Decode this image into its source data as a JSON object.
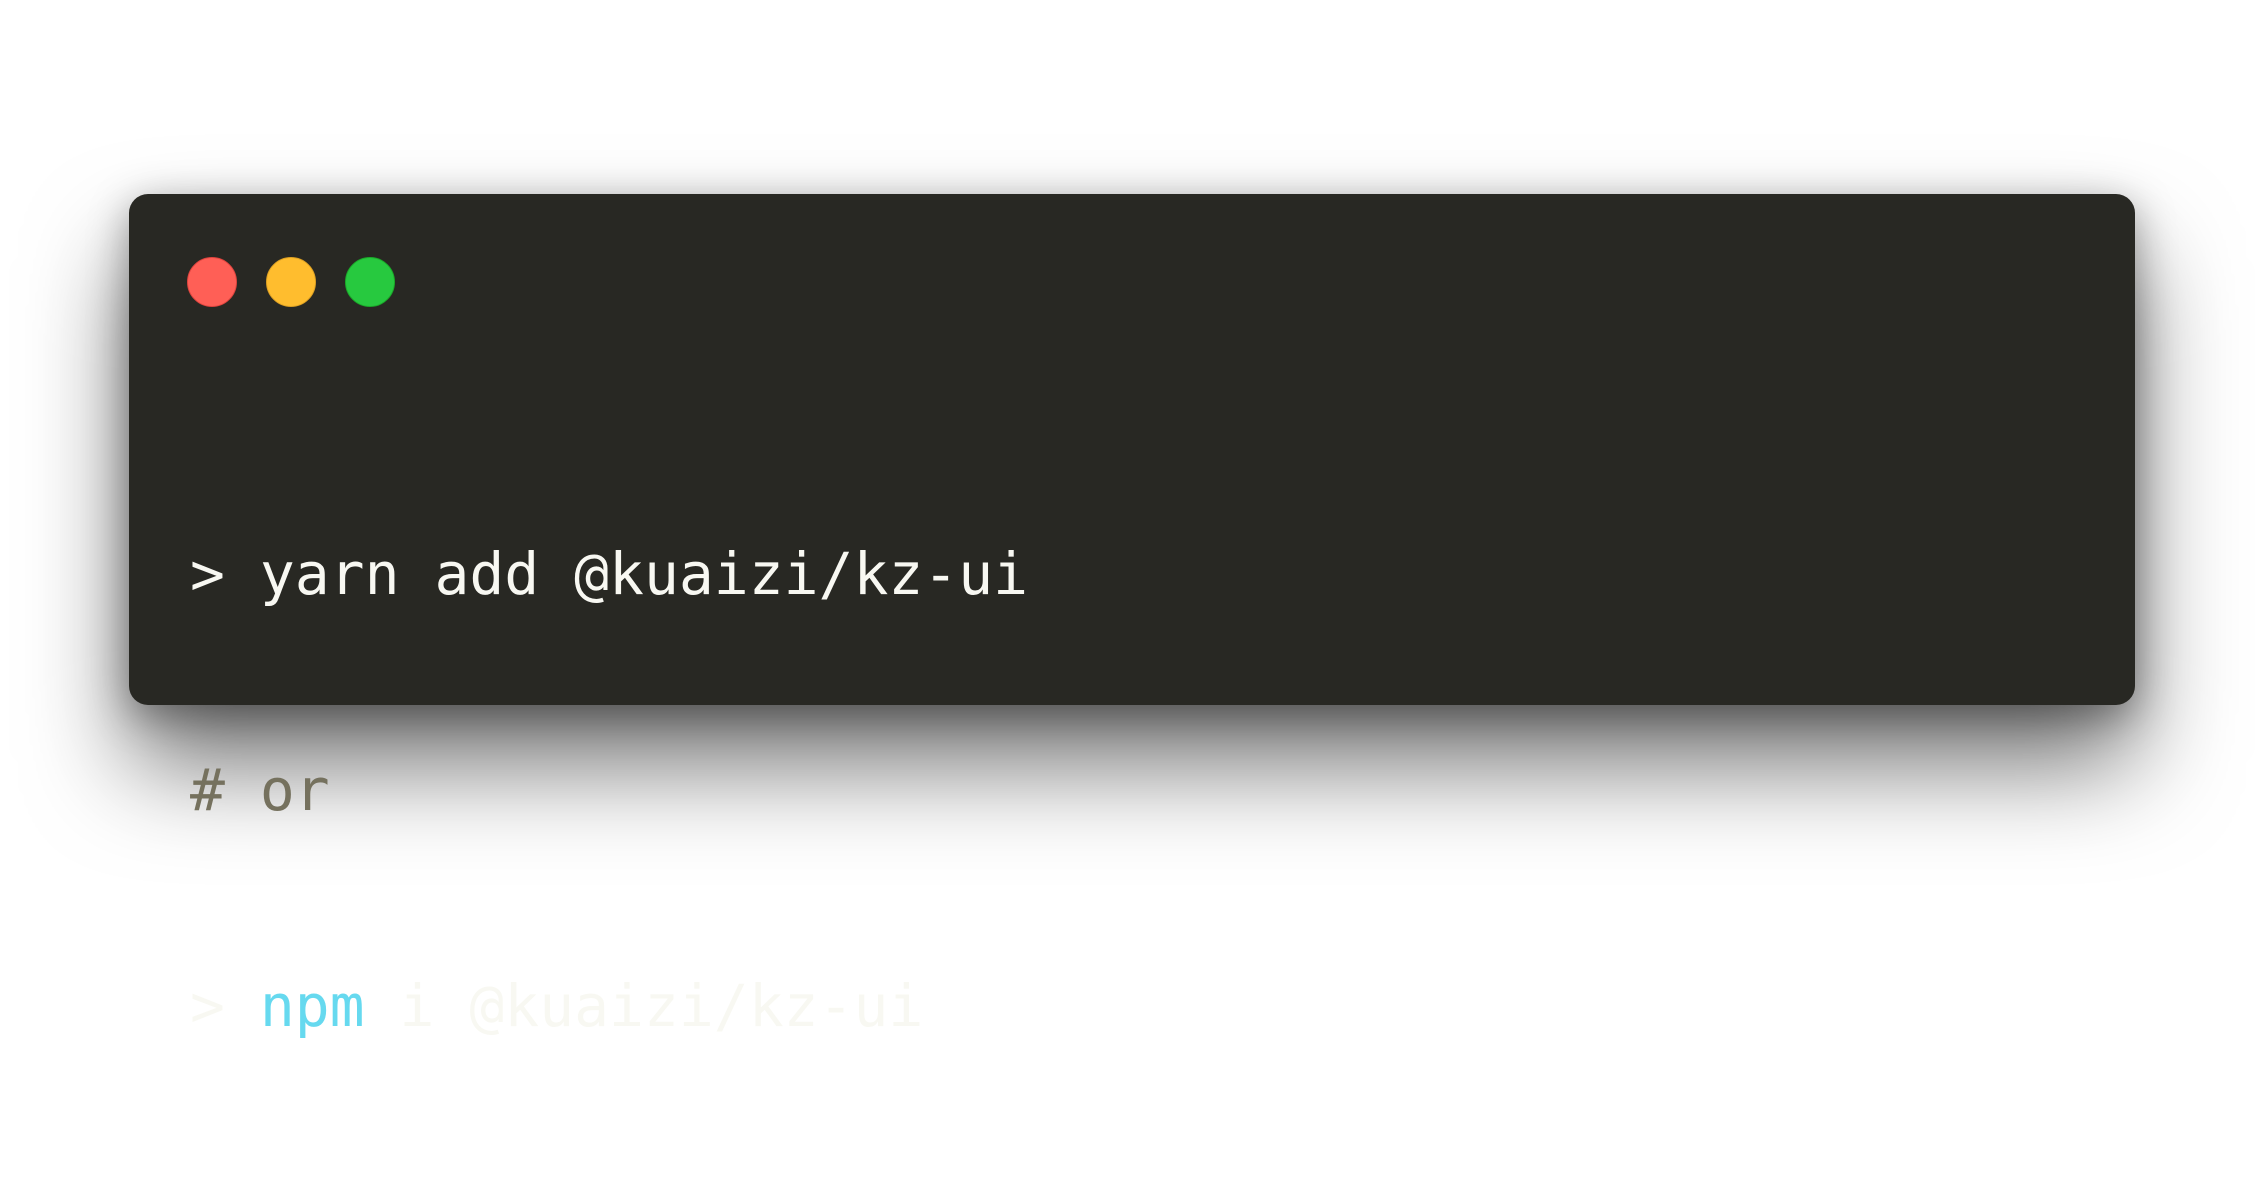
{
  "window": {
    "traffic_lights": [
      {
        "name": "close",
        "color": "#ff5f56",
        "border": "#e0443e"
      },
      {
        "name": "minimize",
        "color": "#ffbd2e",
        "border": "#dea123"
      },
      {
        "name": "maximize",
        "color": "#27c93f",
        "border": "#1aab29"
      }
    ],
    "background_color": "#282823"
  },
  "code": {
    "lines": [
      {
        "tokens": [
          {
            "text": "> ",
            "style": "default"
          },
          {
            "text": "yarn add @kuaizi/kz-ui",
            "style": "default"
          }
        ]
      },
      {
        "tokens": [
          {
            "text": "# or",
            "style": "comment"
          }
        ]
      },
      {
        "tokens": [
          {
            "text": "> ",
            "style": "default"
          },
          {
            "text": "npm",
            "style": "command"
          },
          {
            "text": " i @kuaizi/kz-ui",
            "style": "default"
          }
        ]
      }
    ],
    "colors": {
      "default": "#f8f8f2",
      "comment": "#75715e",
      "command": "#66d9ef"
    }
  }
}
